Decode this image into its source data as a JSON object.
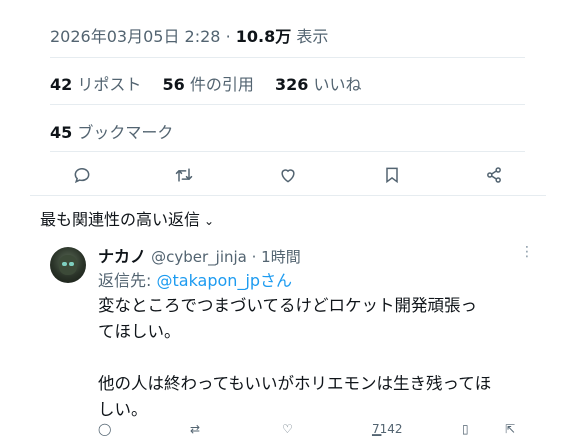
{
  "tweet": {
    "timestamp": "2026年03月05日 2:28",
    "separator": "·",
    "views_count": "10.8万",
    "views_label": "表示",
    "reposts_count": "42",
    "reposts_label": "リポスト",
    "quotes_count": "56",
    "quotes_label": "件の引用",
    "likes_count": "326",
    "likes_label": "いいね",
    "bookmarks_count": "45",
    "bookmarks_label": "ブックマーク",
    "actions": [
      {
        "icon": "reply-icon"
      },
      {
        "icon": "retweet-icon"
      },
      {
        "icon": "like-icon"
      },
      {
        "icon": "bookmark-icon"
      },
      {
        "icon": "share-icon"
      }
    ]
  },
  "replies": {
    "sort_label": "最も関連性の高い返信",
    "items": [
      {
        "name": "ナカノ",
        "handle": "@cyber_jinja",
        "time": "1時間",
        "reply_to_prefix": "返信先: ",
        "reply_to_handle": "@takapon_jpさん",
        "body_lines": [
          "変なところでつまづいてるけどロケット開発頑張っ",
          "てほしい。",
          "他の人は終わってもいいがホリエモンは生き残ってほ",
          "しい。"
        ],
        "views": "7142"
      }
    ]
  },
  "colors": {
    "text": "#0f1419",
    "secondary": "#536471",
    "link": "#1d9bf0",
    "divider": "#e6ecf0"
  }
}
